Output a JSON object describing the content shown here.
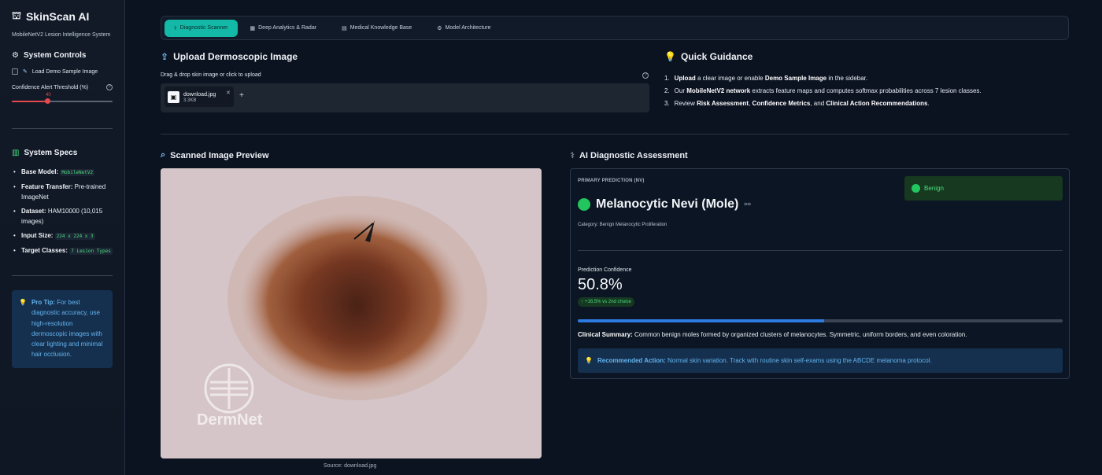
{
  "sidebar": {
    "brand_icon": "⛫",
    "brand": "SkinScan AI",
    "subtitle": "MobileNetV2 Lesion Intelligence System",
    "controls_title": "System Controls",
    "demo_label": "Load Demo Sample Image",
    "threshold_label": "Confidence Alert Threshold (%)",
    "threshold_value": "40",
    "threshold_fraction": 0.4,
    "specs_title": "System Specs",
    "specs": [
      {
        "key": "Base Model:",
        "value": "MobileNetV2",
        "code": true
      },
      {
        "key": "Feature Transfer:",
        "value": "Pre-trained ImageNet",
        "code": false
      },
      {
        "key": "Dataset:",
        "value": "HAM10000 (10,015 images)",
        "code": false
      },
      {
        "key": "Input Size:",
        "value": "224 x 224 x 3",
        "code": true
      },
      {
        "key": "Target Classes:",
        "value": "7 Lesion Types",
        "code": true
      }
    ],
    "tip_title": "Pro Tip:",
    "tip_text": "For best diagnostic accuracy, use high-resolution dermoscopic images with clear lighting and minimal hair occlusion."
  },
  "tabs": [
    {
      "icon": "⚕",
      "label": "Diagnostic Scanner",
      "active": true
    },
    {
      "icon": "▦",
      "label": "Deep Analytics & Radar",
      "active": false
    },
    {
      "icon": "▤",
      "label": "Medical Knowledge Base",
      "active": false
    },
    {
      "icon": "⚙",
      "label": "Model Architecture",
      "active": false
    }
  ],
  "upload": {
    "title": "Upload Dermoscopic Image",
    "label": "Drag & drop skin image or click to upload",
    "file_name": "download.jpg",
    "file_size": "3.3KB"
  },
  "guidance": {
    "title": "Quick Guidance",
    "items": [
      {
        "num": "1.",
        "html": "<b>Upload</b> a clear image or enable <b>Demo Sample Image</b> in the sidebar."
      },
      {
        "num": "2.",
        "html": "Our <b>MobileNetV2 network</b> extracts feature maps and computes softmax probabilities across 7 lesion classes."
      },
      {
        "num": "3.",
        "html": "Review <b>Risk Assessment</b>, <b>Confidence Metrics</b>, and <b>Clinical Action Recommendations</b>."
      }
    ]
  },
  "preview": {
    "title": "Scanned Image Preview",
    "caption": "Source: download.jpg",
    "watermark": "DermNet"
  },
  "diagnosis": {
    "title": "AI Diagnostic Assessment",
    "primary_label": "PRIMARY PREDICTION (NV)",
    "badge": "Benign",
    "prediction": "Melanocytic Nevi (Mole)",
    "category": "Category: Benign Melanocytic Proliferation",
    "confidence_label": "Prediction Confidence",
    "confidence": "50.8%",
    "confidence_fraction": 0.508,
    "delta": "+16.5% vs 2nd choice",
    "summary_label": "Clinical Summary:",
    "summary_text": "Common benign moles formed by organized clusters of melanocytes. Symmetric, uniform borders, and even coloration.",
    "action_label": "Recommended Action:",
    "action_text": "Normal skin variation. Track with routine skin self-exams using the ABCDE melanoma protocol."
  },
  "colors": {
    "accent_teal": "#14b8a6",
    "benign_green": "#22c55e",
    "info_blue": "#63b3ed",
    "slider_red": "#e5484d"
  }
}
